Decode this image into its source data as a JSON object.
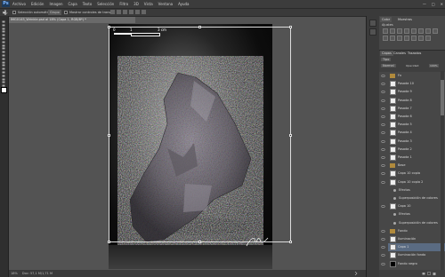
{
  "app": {
    "logo": "Ps"
  },
  "menubar": {
    "items": [
      "Archivo",
      "Edición",
      "Imagen",
      "Capa",
      "Texto",
      "Selección",
      "Filtro",
      "3D",
      "Vista",
      "Ventana",
      "Ayuda"
    ],
    "window_controls": [
      "—",
      "□",
      "✕"
    ]
  },
  "options": {
    "tool_icon": "move-icon",
    "autoselect": "Selección automática:",
    "autoselect_value": "Grupo",
    "transform": "Mostrar controles de transf."
  },
  "document": {
    "tab_title": "IMG0145_Wrinkle.psd al 18% (Capa 1, RGB/8*) *"
  },
  "status": {
    "zoom": "18%",
    "doc": "Doc: 57,1 M/1,71 M"
  },
  "canvas": {
    "scale_labels": [
      "0",
      "1",
      "3 cm"
    ],
    "signature": "Ast"
  },
  "panels": {
    "tabs_top": [
      "Color",
      "Muestras"
    ],
    "adjust_title": "Ajustes",
    "tabs_layers": [
      "Capas",
      "Canales",
      "Trazados"
    ],
    "layers_filter": "Tipo",
    "blend_mode": "Normal",
    "opacity_label": "Opacidad:",
    "opacity_value": "100%",
    "fill_label": "Relleno:",
    "fill_value": "100%"
  },
  "layers": [
    {
      "name": "Fx",
      "type": "folder"
    },
    {
      "name": "Pasada 10",
      "type": "layer"
    },
    {
      "name": "Pasada 9",
      "type": "layer"
    },
    {
      "name": "Pasada 8",
      "type": "layer"
    },
    {
      "name": "Pasada 7",
      "type": "layer"
    },
    {
      "name": "Pasada 6",
      "type": "layer"
    },
    {
      "name": "Pasada 5",
      "type": "layer"
    },
    {
      "name": "Pasada 4",
      "type": "layer"
    },
    {
      "name": "Pasada 3",
      "type": "layer"
    },
    {
      "name": "Pasada 2",
      "type": "layer"
    },
    {
      "name": "Pasada 1",
      "type": "layer"
    },
    {
      "name": "Base",
      "type": "folder"
    },
    {
      "name": "Capa 10 copia",
      "type": "layer"
    },
    {
      "name": "Capa 10 copia 2",
      "type": "layer"
    },
    {
      "name": "Efectos",
      "type": "fx"
    },
    {
      "name": "Superposición de colores",
      "type": "fx"
    },
    {
      "name": "Capa 10",
      "type": "layer"
    },
    {
      "name": "Efectos",
      "type": "fx"
    },
    {
      "name": "Superposición de colores",
      "type": "fx"
    },
    {
      "name": "Fondo",
      "type": "folder"
    },
    {
      "name": "Iluminación",
      "type": "layer"
    },
    {
      "name": "Capa 1",
      "type": "layer"
    },
    {
      "name": "Iluminación fondo",
      "type": "layer"
    },
    {
      "name": "Fondo negro",
      "type": "layer"
    }
  ]
}
